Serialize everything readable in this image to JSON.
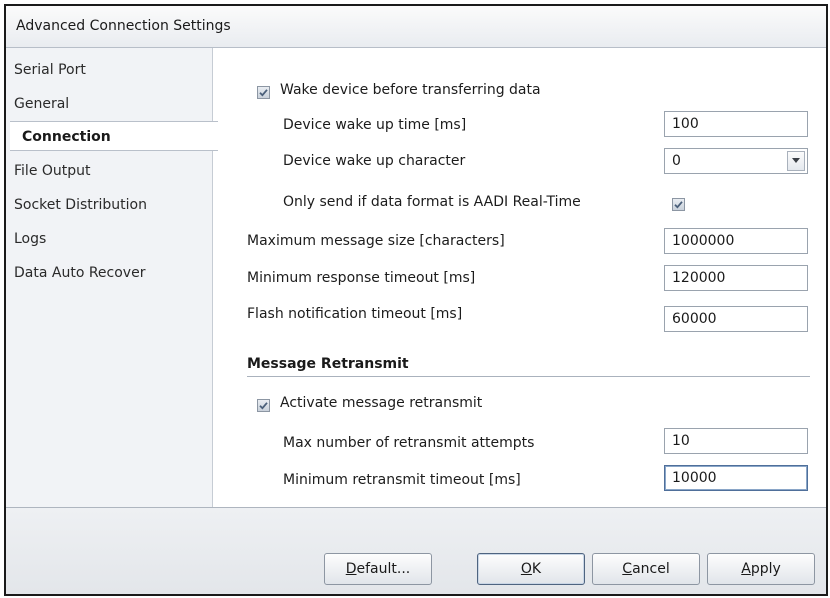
{
  "window": {
    "title": "Advanced Connection Settings"
  },
  "nav": {
    "items": [
      {
        "label": "Serial Port"
      },
      {
        "label": "General"
      },
      {
        "label": "Connection",
        "active": true
      },
      {
        "label": "File Output"
      },
      {
        "label": "Socket Distribution"
      },
      {
        "label": "Logs"
      },
      {
        "label": "Data Auto Recover"
      }
    ]
  },
  "connection": {
    "wake_device": {
      "label": "Wake device before transferring data",
      "checked": true
    },
    "wake_up_time": {
      "label": "Device wake up time [ms]",
      "value": "100"
    },
    "wake_up_char": {
      "label": "Device wake up character",
      "value": "0"
    },
    "only_send_aadi": {
      "label": "Only send if data format is AADI Real-Time",
      "checked": true
    },
    "max_message_size": {
      "label": "Maximum message size [characters]",
      "value": "1000000"
    },
    "min_response_timeout": {
      "label": "Minimum response timeout [ms]",
      "value": "120000"
    },
    "flash_notification_timeout": {
      "label": "Flash notification timeout [ms]",
      "value": "60000"
    }
  },
  "retransmit": {
    "section_title": "Message Retransmit",
    "activate": {
      "label": "Activate message retransmit",
      "checked": true
    },
    "max_attempts": {
      "label": "Max number of retransmit attempts",
      "value": "10"
    },
    "min_timeout": {
      "label": "Minimum retransmit timeout [ms]",
      "value": "10000"
    }
  },
  "buttons": {
    "default": {
      "prefix": "",
      "mnemonic": "D",
      "suffix": "efault..."
    },
    "ok": {
      "prefix": "",
      "mnemonic": "O",
      "suffix": "K"
    },
    "cancel": {
      "prefix": "",
      "mnemonic": "C",
      "suffix": "ancel"
    },
    "apply": {
      "prefix": "",
      "mnemonic": "A",
      "suffix": "pply"
    }
  },
  "colors": {
    "nav_background": "#f1f3f6",
    "accent_border": "#4f6f9a",
    "check_mark": "#4a5f7a"
  },
  "icons": {
    "checkbox": "check-icon",
    "dropdown": "chevron-down-icon"
  }
}
